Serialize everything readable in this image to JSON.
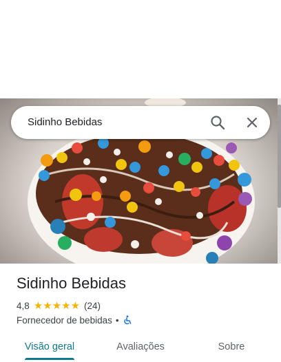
{
  "search": {
    "query": "Sidinho Bebidas"
  },
  "place": {
    "name": "Sidinho Bebidas",
    "rating": "4,8",
    "stars": 5,
    "reviews_count": "(24)",
    "category": "Fornecedor de bebidas",
    "separator": "•"
  },
  "tabs": [
    {
      "label": "Visão geral",
      "active": true
    },
    {
      "label": "Avaliações",
      "active": false
    },
    {
      "label": "Sobre",
      "active": false
    }
  ],
  "colors": {
    "star": "#f4b400",
    "accent": "#0b7a8f",
    "text": "#202124",
    "secondary_text": "#3c4043"
  },
  "icons": [
    "search-icon",
    "close-icon",
    "star-icon",
    "wheelchair-accessible-icon"
  ]
}
